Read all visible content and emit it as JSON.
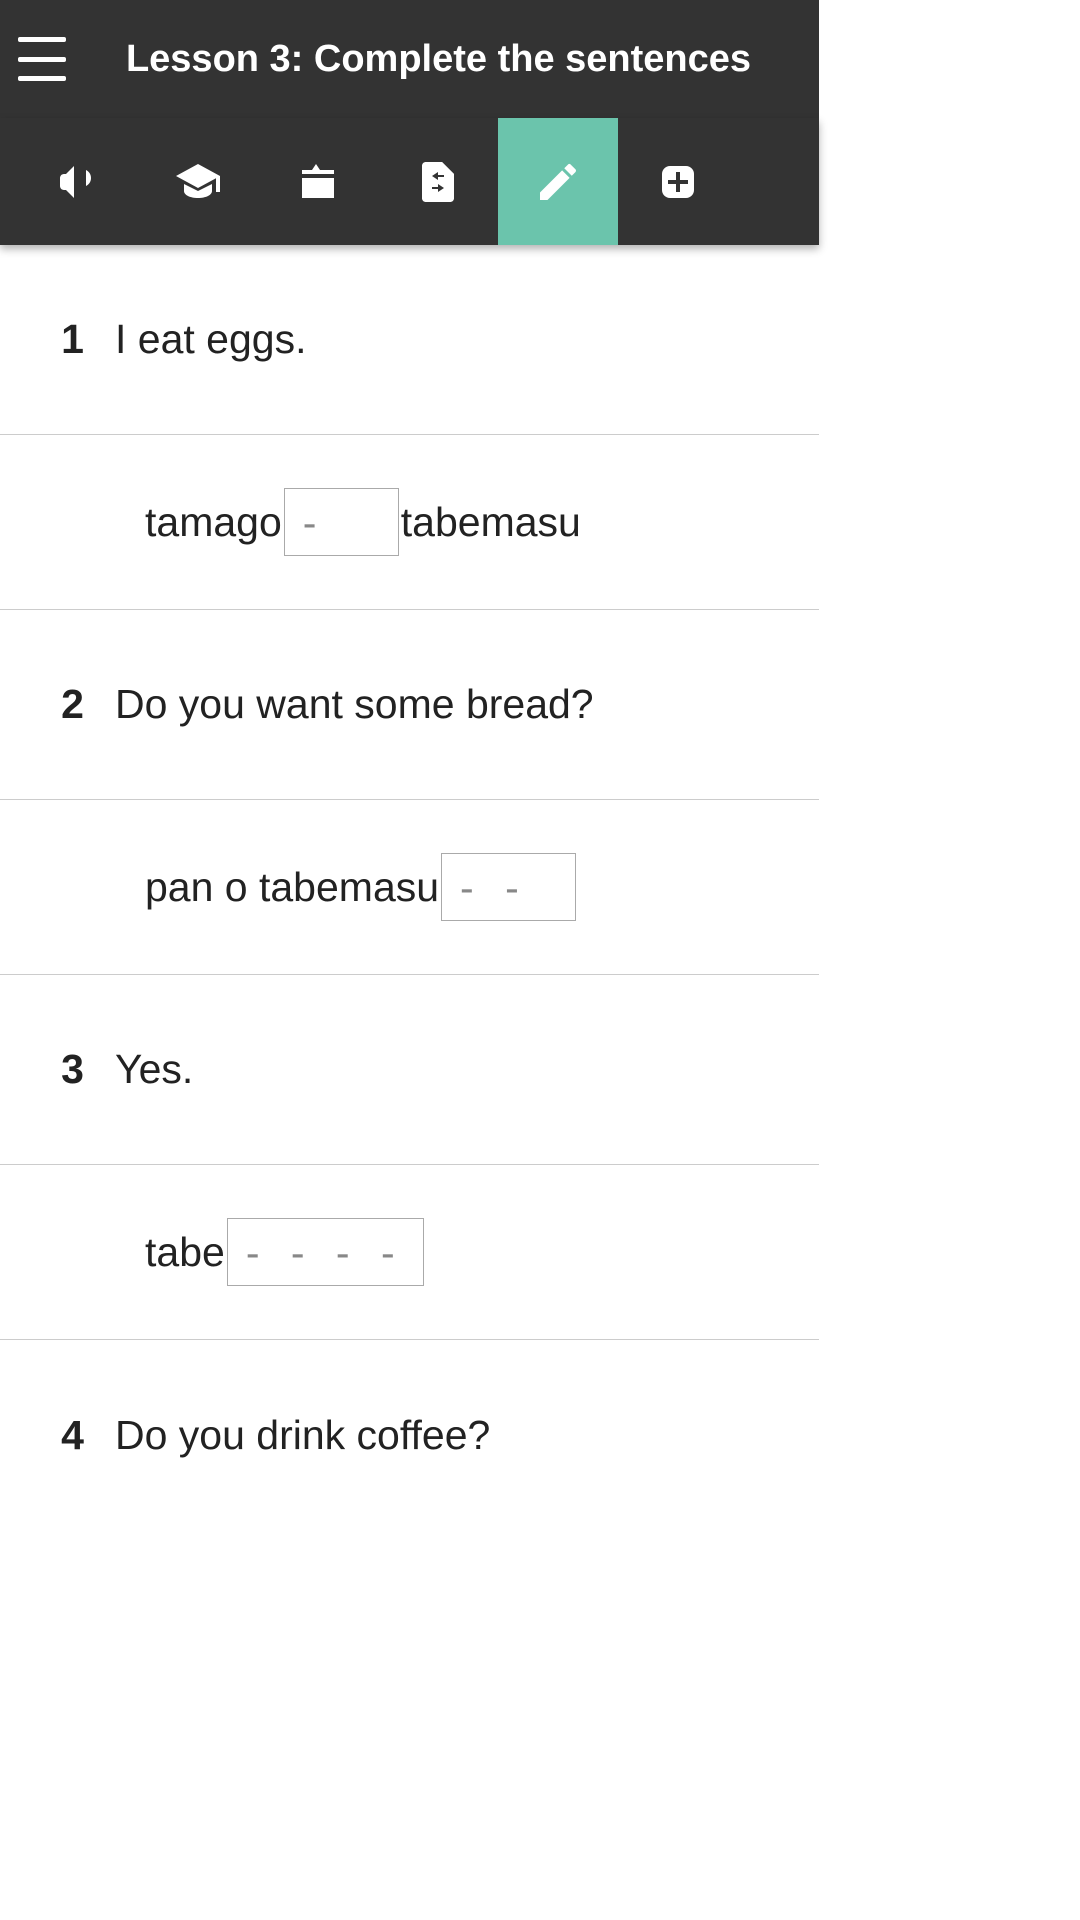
{
  "header": {
    "title": "Lesson 3: Complete the sentences"
  },
  "tabs": {
    "icons": [
      "megaphone-icon",
      "graduation-cap-icon",
      "box-icon",
      "swap-icon",
      "pencil-icon",
      "plus-icon"
    ],
    "activeIndex": 4
  },
  "questions": [
    {
      "number": "1",
      "prompt": "I eat eggs.",
      "answer": {
        "before": "tamago",
        "blank": "-",
        "after": "tabemasu"
      }
    },
    {
      "number": "2",
      "prompt": "Do you want some bread?",
      "answer": {
        "before": "pan o tabemasu",
        "blank": "- -",
        "after": ""
      }
    },
    {
      "number": "3",
      "prompt": "Yes.",
      "answer": {
        "before": "tabe",
        "blank": "- - - -",
        "after": ""
      }
    },
    {
      "number": "4",
      "prompt": "Do you drink coffee?"
    }
  ]
}
